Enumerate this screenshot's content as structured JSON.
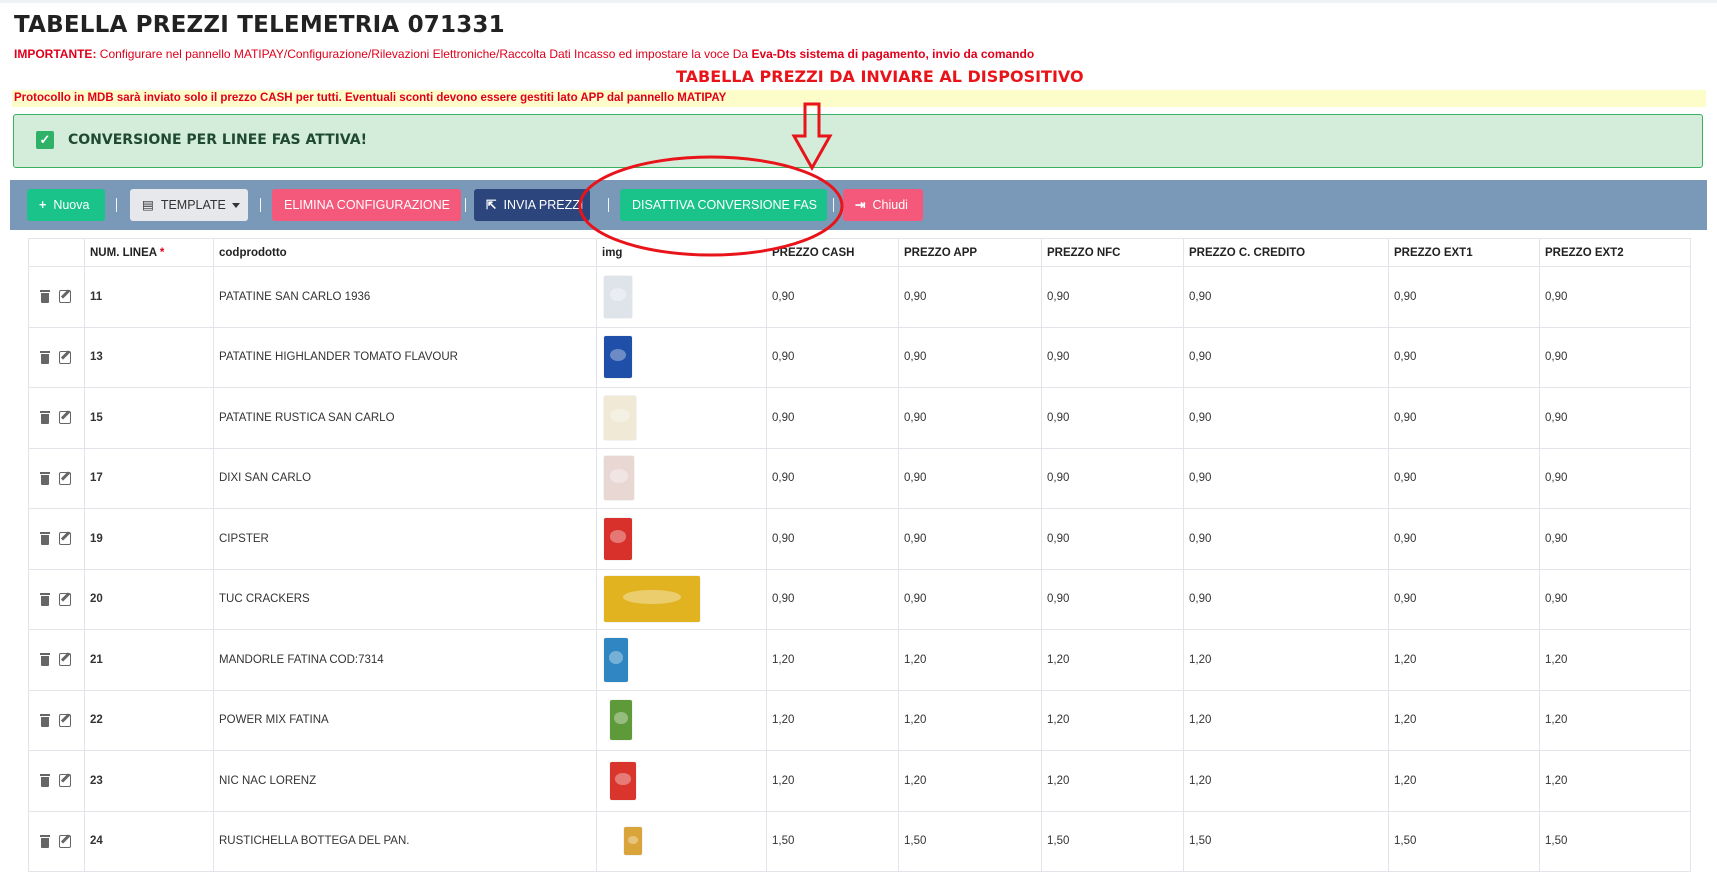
{
  "page": {
    "title": "TABELLA PREZZI TELEMETRIA 071331",
    "important_label": "IMPORTANTE:",
    "important_text": " Configurare nel pannello MATIPAY/Configurazione/Rilevazioni Elettroniche/Raccolta Dati Incasso ed impostare la voce Da ",
    "important_strong": "Eva-Dts sistema di pagamento, invio da comando",
    "annotation": "TABELLA PREZZI DA INVIARE AL DISPOSITIVO",
    "protocol_note": "Protocollo in MDB sarà inviato solo il prezzo CASH per tutti. Eventuali sconti devono essere gestiti lato APP dal pannello MATIPAY",
    "alert_text": "CONVERSIONE PER LINEE FAS ATTIVA!"
  },
  "toolbar": {
    "new_label": "Nuova",
    "template_label": "TEMPLATE",
    "delete_config_label": "ELIMINA CONFIGURAZIONE",
    "send_prices_label": "INVIA PREZZI",
    "disable_fas_label": "DISATTIVA CONVERSIONE FAS",
    "close_label": "Chiudi"
  },
  "table": {
    "headers": {
      "line": "NUM. LINEA",
      "required_mark": "*",
      "code": "codprodotto",
      "img": "img",
      "cash": "PREZZO CASH",
      "app": "PREZZO APP",
      "nfc": "PREZZO NFC",
      "credit": "PREZZO C. CREDITO",
      "ext1": "PREZZO EXT1",
      "ext2": "PREZZO EXT2"
    },
    "rows": [
      {
        "line": "11",
        "code": "PATATINE SAN CARLO 1936",
        "cash": "0,90",
        "app": "0,90",
        "nfc": "0,90",
        "credit": "0,90",
        "ext1": "0,90",
        "ext2": "0,90",
        "img_color": "#dfe3ea"
      },
      {
        "line": "13",
        "code": "PATATINE HIGHLANDER TOMATO FLAVOUR",
        "cash": "0,90",
        "app": "0,90",
        "nfc": "0,90",
        "credit": "0,90",
        "ext1": "0,90",
        "ext2": "0,90",
        "img_color": "#1f4fa8"
      },
      {
        "line": "15",
        "code": "PATATINE RUSTICA SAN CARLO",
        "cash": "0,90",
        "app": "0,90",
        "nfc": "0,90",
        "credit": "0,90",
        "ext1": "0,90",
        "ext2": "0,90",
        "img_color": "#efe9d6"
      },
      {
        "line": "17",
        "code": "DIXI SAN CARLO",
        "cash": "0,90",
        "app": "0,90",
        "nfc": "0,90",
        "credit": "0,90",
        "ext1": "0,90",
        "ext2": "0,90",
        "img_color": "#e9d7d3"
      },
      {
        "line": "19",
        "code": "CIPSTER",
        "cash": "0,90",
        "app": "0,90",
        "nfc": "0,90",
        "credit": "0,90",
        "ext1": "0,90",
        "ext2": "0,90",
        "img_color": "#d8312b"
      },
      {
        "line": "20",
        "code": "TUC CRACKERS",
        "cash": "0,90",
        "app": "0,90",
        "nfc": "0,90",
        "credit": "0,90",
        "ext1": "0,90",
        "ext2": "0,90",
        "img_color": "#e2b321"
      },
      {
        "line": "21",
        "code": "MANDORLE FATINA COD:7314",
        "cash": "1,20",
        "app": "1,20",
        "nfc": "1,20",
        "credit": "1,20",
        "ext1": "1,20",
        "ext2": "1,20",
        "img_color": "#2f86c2"
      },
      {
        "line": "22",
        "code": "POWER MIX FATINA",
        "cash": "1,20",
        "app": "1,20",
        "nfc": "1,20",
        "credit": "1,20",
        "ext1": "1,20",
        "ext2": "1,20",
        "img_color": "#5f9a3a"
      },
      {
        "line": "23",
        "code": "NIC NAC LORENZ",
        "cash": "1,20",
        "app": "1,20",
        "nfc": "1,20",
        "credit": "1,20",
        "ext1": "1,20",
        "ext2": "1,20",
        "img_color": "#d9352c"
      },
      {
        "line": "24",
        "code": "RUSTICHELLA BOTTEGA DEL PAN.",
        "cash": "1,50",
        "app": "1,50",
        "nfc": "1,50",
        "credit": "1,50",
        "ext1": "1,50",
        "ext2": "1,50",
        "img_color": "#d9a53a"
      }
    ]
  },
  "colors": {
    "alert_green": "#2fb268",
    "annotation_red": "#e8141a",
    "toolbar_bg": "#7a99b9"
  },
  "icons": [
    "plus-icon",
    "file-icon",
    "caret-down-icon",
    "share-icon",
    "sign-out-icon",
    "check-icon",
    "trash-icon",
    "edit-icon",
    "down-arrow-annotation-icon"
  ]
}
